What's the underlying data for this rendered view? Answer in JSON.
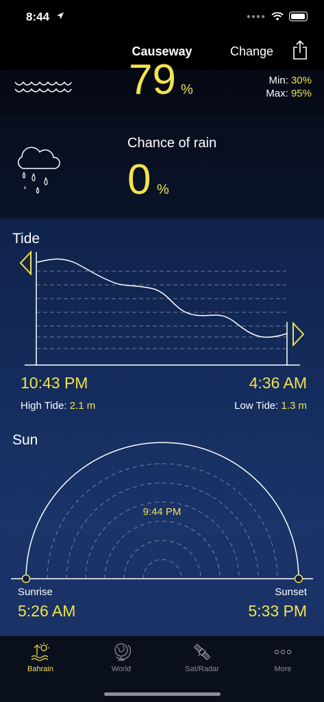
{
  "status": {
    "time": "8:44"
  },
  "nav": {
    "title": "Causeway",
    "change_label": "Change"
  },
  "humidity": {
    "value": "79",
    "unit": "%",
    "min_label": "Min:",
    "min_value": "30%",
    "max_label": "Max:",
    "max_value": "95%"
  },
  "rain": {
    "title": "Chance of rain",
    "value": "0",
    "unit": "%"
  },
  "tide": {
    "title": "Tide",
    "high_time": "10:43 PM",
    "low_time": "4:36 AM",
    "high_label": "High Tide:",
    "high_value": "2.1 m",
    "low_label": "Low Tide:",
    "low_value": "1.3 m"
  },
  "sun": {
    "title": "Sun",
    "current_time": "9:44 PM",
    "sunrise_label": "Sunrise",
    "sunrise_time": "5:26 AM",
    "sunset_label": "Sunset",
    "sunset_time": "5:33 PM"
  },
  "tabs": [
    {
      "label": "Bahrain",
      "icon": "beach-sun-icon",
      "active": true
    },
    {
      "label": "World",
      "icon": "globe-icon",
      "active": false
    },
    {
      "label": "Sat/Radar",
      "icon": "satellite-icon",
      "active": false
    },
    {
      "label": "More",
      "icon": "more-dots-icon",
      "active": false
    }
  ],
  "colors": {
    "accent": "#f2e34b",
    "background_top": "#060a14",
    "background_bottom": "#1a2d5c"
  }
}
